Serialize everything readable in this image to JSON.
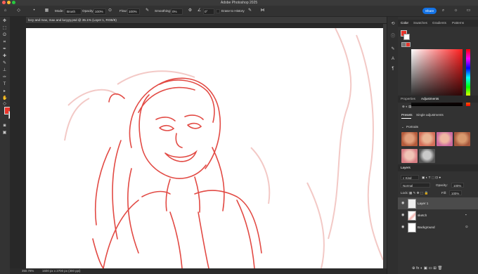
{
  "app": {
    "title": "Adobe Photoshop 2025"
  },
  "options_bar": {
    "mode_label": "Mode:",
    "mode_value": "Brush",
    "opacity_label": "Opacity:",
    "opacity_value": "100%",
    "flow_label": "Flow:",
    "flow_value": "100%",
    "smoothing_label": "Smoothing:",
    "smoothing_value": "0%",
    "angle_value": "0°",
    "erase_history_label": "Erase to History",
    "share_label": "Share"
  },
  "document": {
    "tab_title": "locy and max, max and lucyyy.psd @ 35.1% (Layer 1, RGB/8)",
    "zoom": "350.78%",
    "doc_size": "1600 px x 2700 px (300 ppi)"
  },
  "colors": {
    "foreground": "#e8332a",
    "background": "#ffffff",
    "accent": "#1473e6",
    "sketch": "#e24a44"
  },
  "color_panel": {
    "tabs": [
      "Color",
      "Swatches",
      "Gradients",
      "Patterns"
    ]
  },
  "adjust_panel": {
    "tabs": [
      "Properties",
      "Adjustments"
    ],
    "subtabs": [
      "Presets",
      "Single adjustments"
    ],
    "group": "Portraits"
  },
  "layers_panel": {
    "title": "Layers",
    "filter": "Kind",
    "blend_mode": "Normal",
    "opacity_label": "Opacity:",
    "opacity_value": "100%",
    "lock_label": "Lock:",
    "fill_label": "Fill:",
    "fill_value": "100%",
    "layers": [
      {
        "name": "Layer 1",
        "selected": true
      },
      {
        "name": "sketch",
        "selected": false
      },
      {
        "name": "Background",
        "selected": false
      }
    ]
  }
}
